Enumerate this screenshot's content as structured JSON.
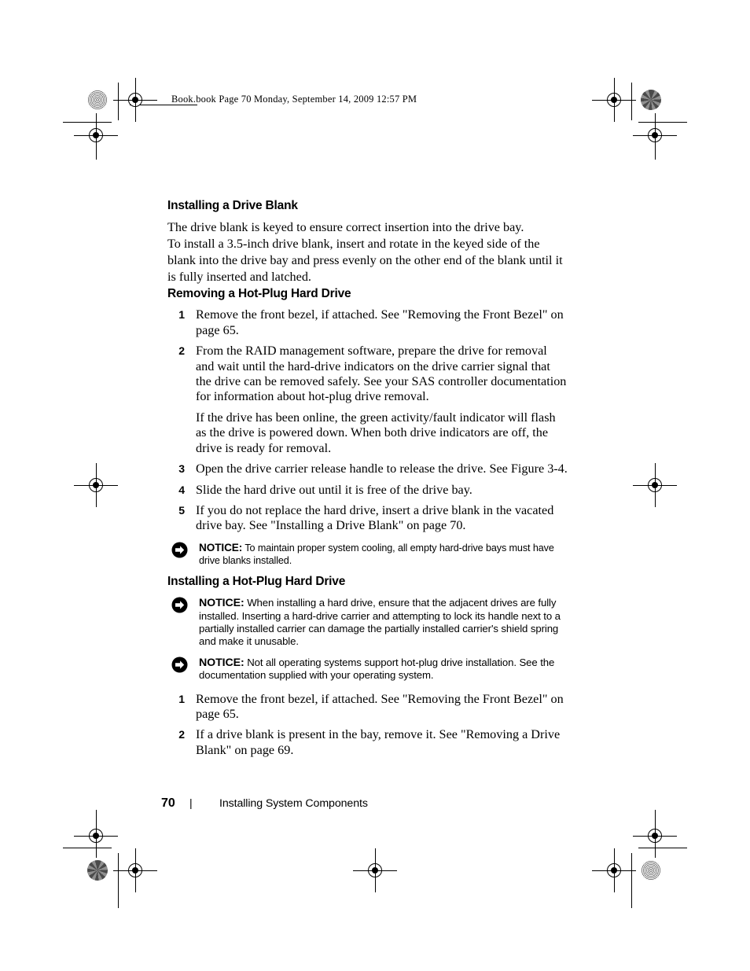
{
  "header": {
    "text": "Book.book  Page 70  Monday, September 14, 2009  12:57 PM"
  },
  "sections": [
    {
      "heading": "Installing a Drive Blank",
      "paragraphs": [
        "The drive blank is keyed to ensure correct insertion into the drive bay.",
        "To install a 3.5-inch drive blank, insert and rotate in the keyed side of the",
        "blank into the drive bay and press evenly on the other end of the blank until it",
        "is fully inserted and latched."
      ]
    },
    {
      "heading": "Removing a Hot-Plug Hard Drive",
      "steps": [
        {
          "num": "1",
          "text": "Remove the front bezel, if attached. See \"Removing the Front Bezel\" on page 65."
        },
        {
          "num": "2",
          "text": "From the RAID management software, prepare the drive for removal and wait until the hard-drive indicators on the drive carrier signal that the drive can be removed safely. See your SAS controller documentation for information about hot-plug drive removal.",
          "subpara": "If the drive has been online, the green activity/fault indicator will flash as the drive is powered down. When both drive indicators are off, the drive is ready for removal."
        },
        {
          "num": "3",
          "text": "Open the drive carrier release handle to release the drive. See Figure 3-4."
        },
        {
          "num": "4",
          "text": "Slide the hard drive out until it is free of the drive bay."
        },
        {
          "num": "5",
          "text": "If you do not replace the hard drive, insert a drive blank in the vacated drive bay. See \"Installing a Drive Blank\" on page 70."
        }
      ],
      "notice": {
        "label": "NOTICE:",
        "text": "To maintain proper system cooling, all empty hard-drive bays must have drive blanks installed."
      }
    },
    {
      "heading": "Installing a Hot-Plug Hard Drive",
      "notices": [
        {
          "label": "NOTICE:",
          "text": "When installing a hard drive, ensure that the adjacent drives are fully installed. Inserting a hard-drive carrier and attempting to lock its handle next to a partially installed carrier can damage the partially installed carrier's shield spring and make it unusable."
        },
        {
          "label": "NOTICE:",
          "text": "Not all operating systems support hot-plug drive installation. See the documentation supplied with your operating system."
        }
      ],
      "steps": [
        {
          "num": "1",
          "text": "Remove the front bezel, if attached. See \"Removing the Front Bezel\" on page 65."
        },
        {
          "num": "2",
          "text": "If a drive blank is present in the bay, remove it. See \"Removing a Drive Blank\" on page 69."
        }
      ]
    }
  ],
  "footer": {
    "page_number": "70",
    "separator": "|",
    "title": "Installing System Components"
  }
}
